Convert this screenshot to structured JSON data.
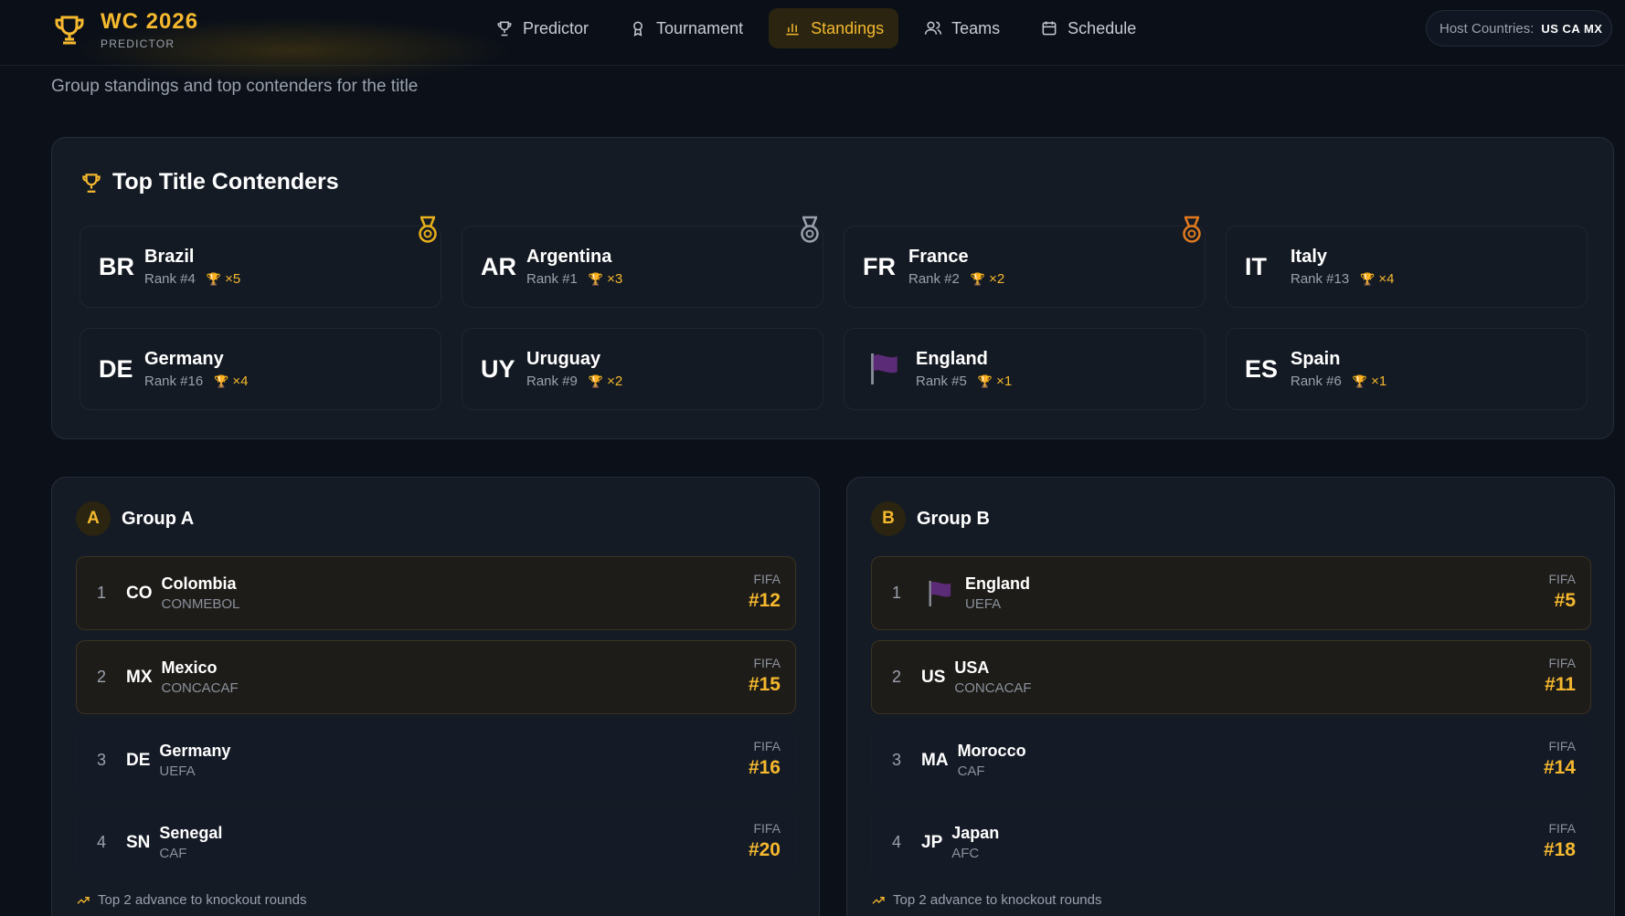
{
  "brand": {
    "title": "WC 2026",
    "subtitle": "PREDICTOR"
  },
  "nav": {
    "tabs": [
      {
        "label": "Predictor",
        "icon": "trophy-icon"
      },
      {
        "label": "Tournament",
        "icon": "award-icon"
      },
      {
        "label": "Standings",
        "icon": "bar-chart-icon",
        "active": true
      },
      {
        "label": "Teams",
        "icon": "users-icon"
      },
      {
        "label": "Schedule",
        "icon": "calendar-icon"
      }
    ]
  },
  "host": {
    "label": "Host Countries:",
    "codes": "US CA MX"
  },
  "page": {
    "subtitle": "Group standings and top contenders for the title"
  },
  "contenders": {
    "title": "Top Title Contenders",
    "items": [
      {
        "code": "BR",
        "name": "Brazil",
        "rank": "Rank #4",
        "titles": "×5",
        "medal": "gold"
      },
      {
        "code": "AR",
        "name": "Argentina",
        "rank": "Rank #1",
        "titles": "×3",
        "medal": "silver"
      },
      {
        "code": "FR",
        "name": "France",
        "rank": "Rank #2",
        "titles": "×2",
        "medal": "bronze"
      },
      {
        "code": "IT",
        "name": "Italy",
        "rank": "Rank #13",
        "titles": "×4"
      },
      {
        "code": "DE",
        "name": "Germany",
        "rank": "Rank #16",
        "titles": "×4"
      },
      {
        "code": "UY",
        "name": "Uruguay",
        "rank": "Rank #9",
        "titles": "×2"
      },
      {
        "code": "",
        "name": "England",
        "rank": "Rank #5",
        "titles": "×1",
        "flag": true
      },
      {
        "code": "ES",
        "name": "Spain",
        "rank": "Rank #6",
        "titles": "×1"
      }
    ]
  },
  "groups": [
    {
      "letter": "A",
      "title": "Group A",
      "footer": "Top 2 advance to knockout rounds",
      "rows": [
        {
          "pos": "1",
          "code": "CO",
          "name": "Colombia",
          "conf": "CONMEBOL",
          "fifa_label": "FIFA",
          "fifa": "#12",
          "advance": true
        },
        {
          "pos": "2",
          "code": "MX",
          "name": "Mexico",
          "conf": "CONCACAF",
          "fifa_label": "FIFA",
          "fifa": "#15",
          "advance": true
        },
        {
          "pos": "3",
          "code": "DE",
          "name": "Germany",
          "conf": "UEFA",
          "fifa_label": "FIFA",
          "fifa": "#16",
          "advance": false
        },
        {
          "pos": "4",
          "code": "SN",
          "name": "Senegal",
          "conf": "CAF",
          "fifa_label": "FIFA",
          "fifa": "#20",
          "advance": false
        }
      ]
    },
    {
      "letter": "B",
      "title": "Group B",
      "footer": "Top 2 advance to knockout rounds",
      "rows": [
        {
          "pos": "1",
          "code": "",
          "name": "England",
          "conf": "UEFA",
          "fifa_label": "FIFA",
          "fifa": "#5",
          "advance": true,
          "flag": true
        },
        {
          "pos": "2",
          "code": "US",
          "name": "USA",
          "conf": "CONCACAF",
          "fifa_label": "FIFA",
          "fifa": "#11",
          "advance": true
        },
        {
          "pos": "3",
          "code": "MA",
          "name": "Morocco",
          "conf": "CAF",
          "fifa_label": "FIFA",
          "fifa": "#14",
          "advance": false
        },
        {
          "pos": "4",
          "code": "JP",
          "name": "Japan",
          "conf": "AFC",
          "fifa_label": "FIFA",
          "fifa": "#18",
          "advance": false
        }
      ]
    }
  ],
  "colors": {
    "accent": "#f5b82e",
    "background": "#0c1119",
    "panel": "#151b25",
    "gold": "#e8b01a",
    "silver": "#9aa1ad",
    "bronze": "#e07a1f"
  }
}
